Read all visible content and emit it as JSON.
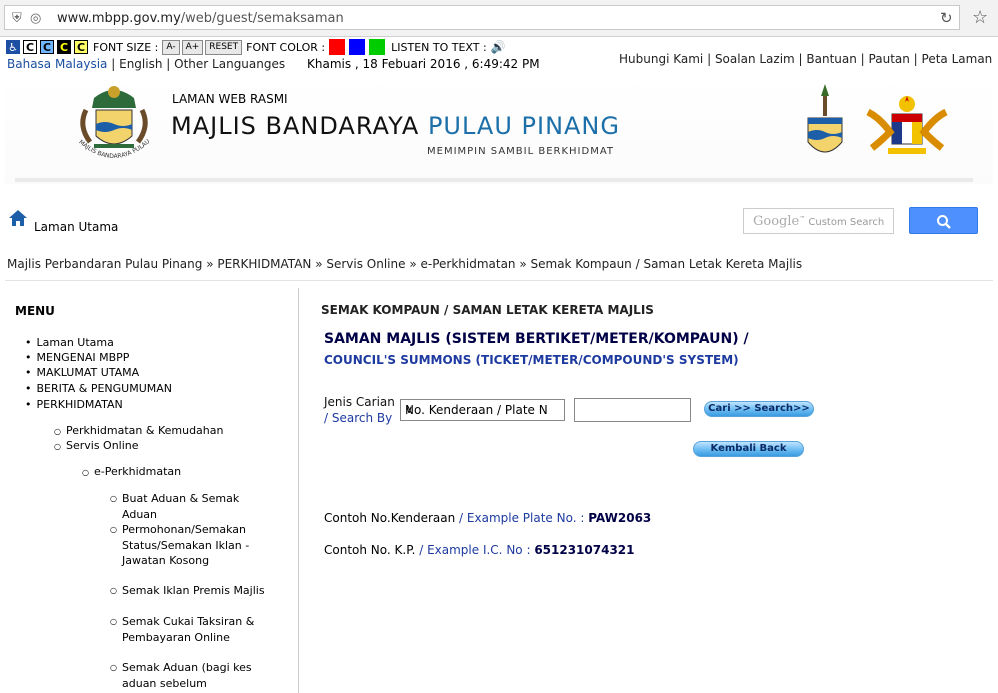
{
  "browser": {
    "url_host": "www.mbpp.gov.my",
    "url_path": "/web/guest/semaksaman"
  },
  "toolbar": {
    "font_size_label": "FONT SIZE :",
    "font_minus": "A-",
    "font_plus": "A+",
    "font_reset": "RESET",
    "font_color_label": "FONT COLOR :",
    "listen_label": "LISTEN TO TEXT :",
    "contrast_label": "C",
    "colors": [
      "#ff0000",
      "#0000ff",
      "#00cc00"
    ]
  },
  "lang": {
    "malay": "Bahasa Malaysia",
    "english": "English",
    "other": "Other Languanges",
    "separator": "|"
  },
  "datetime": "Khamis , 18 Febuari 2016 , 6:49:42 PM",
  "top_links": [
    "Hubungi Kami",
    "Soalan Lazim",
    "Bantuan",
    "Pautan",
    "Peta Laman"
  ],
  "header": {
    "kicker": "LAMAN WEB RASMI",
    "title_part1": "MAJLIS BANDARAYA ",
    "title_part2": "PULAU PINANG",
    "tagline": "MEMIMPIN SAMBIL BERKHIDMAT",
    "logo_text": "MAJLIS BANDARAYA PULAU PINANG"
  },
  "nav": {
    "home_label": "Laman Utama",
    "search_brand": "Google",
    "search_placeholder": "Custom Search"
  },
  "breadcrumb": "Majlis Perbandaran Pulau Pinang » PERKHIDMATAN » Servis Online » e-Perkhidmatan » Semak Kompaun / Saman Letak Kereta Majlis",
  "sidebar": {
    "title": "MENU",
    "level1": [
      "Laman Utama",
      "MENGENAI MBPP",
      "MAKLUMAT UTAMA",
      "BERITA & PENGUMUMAN",
      "PERKHIDMATAN"
    ],
    "level2": [
      "Perkhidmatan & Kemudahan",
      "Servis Online"
    ],
    "level3": [
      "e-Perkhidmatan"
    ],
    "level4": [
      "Buat Aduan & Semak Aduan",
      "Permohonan/Semakan Status/Semakan Iklan - Jawatan Kosong",
      "Semak Iklan Premis Majlis",
      "Semak Cukai Taksiran & Pembayaran Online",
      "Semak Aduan (bagi kes aduan sebelum"
    ]
  },
  "main": {
    "page_title": "SEMAK KOMPAUN / SAMAN LETAK KERETA MAJLIS",
    "summons_title": "SAMAN MAJLIS (SISTEM BERTIKET/METER/KOMPAUN) /",
    "summons_sub": "COUNCIL'S SUMMONS (TICKET/METER/COMPOUND'S SYSTEM)",
    "search_label_ms": "Jenis Carian",
    "search_label_en": "/ Search By",
    "search_type_selected": "No. Kenderaan / Plate No",
    "search_value": "",
    "search_button": "Cari >> Search>>",
    "back_button": "Kembali Back",
    "example_plate_ms": "Contoh No.Kenderaan",
    "example_plate_en": " / Example Plate No. : ",
    "example_plate_value": "PAW2063",
    "example_ic_ms": "Contoh No. K.P.",
    "example_ic_en": " / Example I.C. No : ",
    "example_ic_value": "651231074321"
  }
}
